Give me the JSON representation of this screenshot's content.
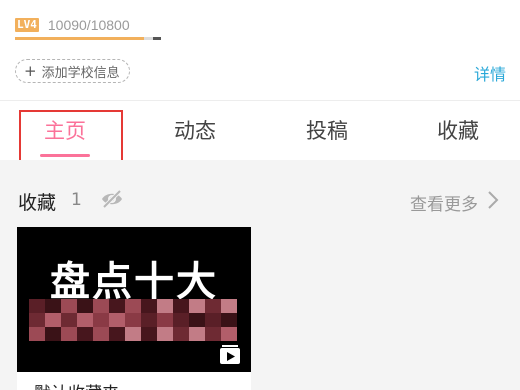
{
  "profile": {
    "level_badge": "LV4",
    "exp_text": "10090/10800",
    "exp_progress": 0.934,
    "school_button": "添加学校信息",
    "detail_link": "详情"
  },
  "tabs": [
    {
      "label": "主页",
      "active": true
    },
    {
      "label": "动态",
      "active": false
    },
    {
      "label": "投稿",
      "active": false
    },
    {
      "label": "收藏",
      "active": false
    }
  ],
  "favorites": {
    "title": "收藏",
    "count": "1",
    "see_more": "查看更多",
    "items": [
      {
        "cover_title": "盘点十大",
        "label": "默认收藏夹",
        "icon": "playlist-play-icon"
      }
    ]
  },
  "colors": {
    "accent": "#fb7299",
    "link": "#2aa8d8",
    "level": "#f2b05c",
    "highlight_box": "#e53935"
  }
}
